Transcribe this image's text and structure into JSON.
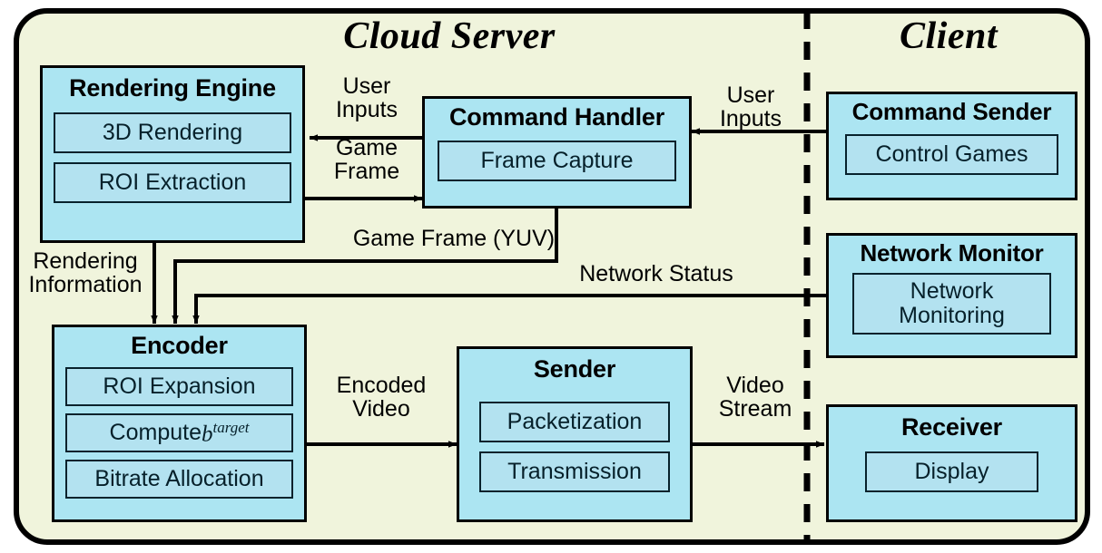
{
  "diagram": {
    "title_left": "Cloud Server",
    "title_right": "Client",
    "colors": {
      "panel_background": "#f0f4dc",
      "module_fill": "#ace5f2",
      "submodule_fill": "#b3e2f0",
      "stroke": "#000000"
    }
  },
  "modules": {
    "rendering_engine": {
      "title": "Rendering Engine",
      "sub1": "3D Rendering",
      "sub2": "ROI Extraction"
    },
    "command_handler": {
      "title": "Command Handler",
      "sub1": "Frame Capture"
    },
    "command_sender": {
      "title": "Command Sender",
      "sub1": "Control Games"
    },
    "network_monitor": {
      "title": "Network Monitor",
      "sub1": "Network\nMonitoring"
    },
    "encoder": {
      "title": "Encoder",
      "sub1": "ROI Expansion",
      "sub2_prefix": "Compute ",
      "sub2_base": "b",
      "sub2_sup": "target",
      "sub3": "Bitrate Allocation"
    },
    "sender": {
      "title": "Sender",
      "sub1": "Packetization",
      "sub2": "Transmission"
    },
    "receiver": {
      "title": "Receiver",
      "sub1": "Display"
    }
  },
  "flows": {
    "user_inputs_server": "User\nInputs",
    "game_frame": "Game\nFrame",
    "user_inputs_client": "User\nInputs",
    "game_frame_yuv": "Game Frame (YUV)",
    "rendering_information": "Rendering\nInformation",
    "network_status": "Network Status",
    "encoded_video": "Encoded\nVideo",
    "video_stream": "Video\nStream"
  }
}
